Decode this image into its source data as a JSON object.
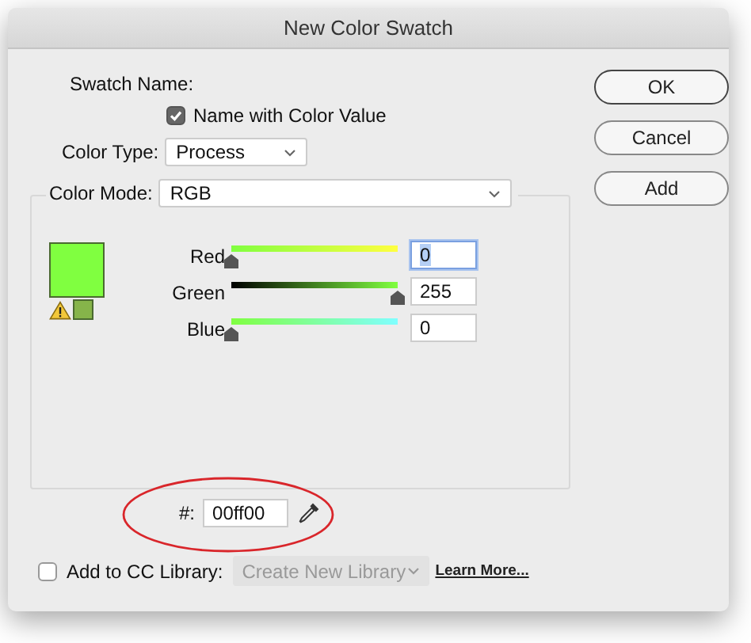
{
  "window": {
    "title": "New Color Swatch"
  },
  "swatch_name": {
    "label": "Swatch Name:",
    "name_with_color_value": {
      "label": "Name with Color Value",
      "checked": true
    }
  },
  "color_type": {
    "label": "Color Type:",
    "value": "Process"
  },
  "color_mode": {
    "label": "Color Mode:",
    "value": "RGB"
  },
  "out_of_gamut": true,
  "channels": [
    {
      "name": "Red",
      "level": 0,
      "value": "0",
      "focused": true
    },
    {
      "name": "Green",
      "level": 1,
      "value": "255",
      "focused": false
    },
    {
      "name": "Blue",
      "level": 0,
      "value": "0",
      "focused": false
    }
  ],
  "hex": {
    "label": "#:",
    "value": "00ff00"
  },
  "cc_library": {
    "label": "Add to CC Library:",
    "checked": false,
    "library": "Create New Library",
    "link": "Learn More..."
  },
  "buttons": [
    {
      "label": "OK",
      "default": true
    },
    {
      "label": "Cancel",
      "default": false
    },
    {
      "label": "Add",
      "default": false
    }
  ]
}
